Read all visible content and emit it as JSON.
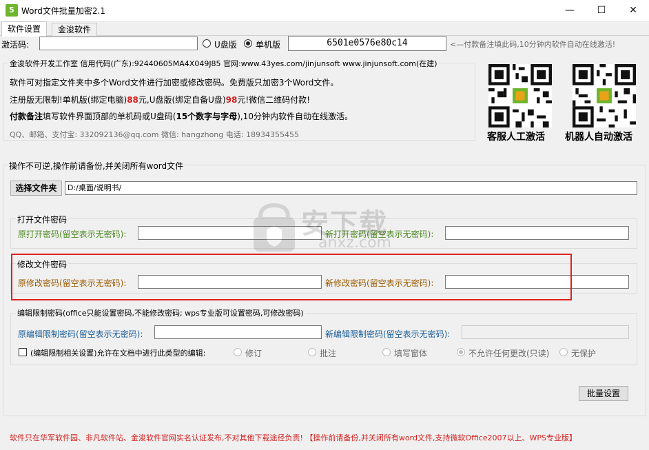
{
  "window": {
    "title": "Word文件批量加密2.1",
    "icon_letter": "5",
    "minimize": "—",
    "maximize": "☐",
    "close": "✕"
  },
  "tabs": [
    {
      "label": "软件设置"
    },
    {
      "label": "金浚软件"
    }
  ],
  "activation": {
    "code_label": "激活码:",
    "code_value": "",
    "usb_label": "U盘版",
    "single_label": "单机版",
    "selected": "单机版",
    "machine_code": "6501e0576e80c14",
    "hint": "<—付款备注填此码,10分钟内软件自动在线激活!"
  },
  "company": {
    "header": "金浚软件开发工作室 信用代码(广东):92440605MA4X049J85 官网:www.43yes.com/jinjunsoft  www.jinjunsoft.com(在建)",
    "line1": "软件可对指定文件夹中多个Word文件进行加密或修改密码。免费版只加密3个Word文件。",
    "line2_a": "注册版无限制!单机版(绑定电脑)",
    "line2_price1": "88",
    "line2_b": "元,U盘版(绑定自备U盘)",
    "line2_price2": "98",
    "line2_c": "元!微信二维码付款!",
    "line3_bold": "付款备注",
    "line3_a": "填写软件界面顶部的单机码或U盘码(",
    "line3_bold2": "15个数字与字母",
    "line3_b": "),10分钟内软件自动在线激活。",
    "contact": "QQ、邮箱、支付宝: 332092136@qq.com    微信: hangzhong    电话: 18934355455",
    "qr1_label": "客服人工激活",
    "qr2_label": "机器人自动激活"
  },
  "main_group": {
    "title": "操作不可逆,操作前请备份,并关闭所有word文件",
    "choose_folder": "选择文件夹",
    "folder_path": "D:/桌面/说明书/"
  },
  "open_password": {
    "title": "打开文件密码",
    "old_label": "原打开密码(留空表示无密码):",
    "old_value": "",
    "new_label": "新打开密码(留空表示无密码):",
    "new_value": ""
  },
  "modify_password": {
    "title": "修改文件密码",
    "old_label": "原修改密码(留空表示无密码):",
    "old_value": "",
    "new_label": "新修改密码(留空表示无密码):",
    "new_value": ""
  },
  "edit_restrict": {
    "title": "编辑限制密码(office只能设置密码,不能修改密码; wps专业版可设置密码,可修改密码)",
    "old_label": "原编辑限制密码(留空表示无密码):",
    "old_value": "",
    "new_label": "新编辑限制密码(留空表示无密码):",
    "new_value": "",
    "check_label": "(编辑限制相关设置)允许在文档中进行此类型的编辑:",
    "options": [
      "修订",
      "批注",
      "填写窗体",
      "不允许任何更改(只读)",
      "无保护"
    ],
    "selected": "不允许任何更改(只读)"
  },
  "batch_button": "批量设置",
  "footer": "软件只在华军软件园、非凡软件站、金浚软件官网实名认证发布,不对其他下载途径负责! 【操作前请备份,并关闭所有word文件,支持微软Office2007以上、WPS专业版】",
  "watermark": {
    "text": "安下载",
    "sub": "anxz.com"
  },
  "colors": {
    "highlight_border": "#e02020",
    "price_red": "#d42020",
    "label_green": "#4c8a1f",
    "label_brown": "#9a5a00",
    "label_blue": "#1b5f9a"
  }
}
